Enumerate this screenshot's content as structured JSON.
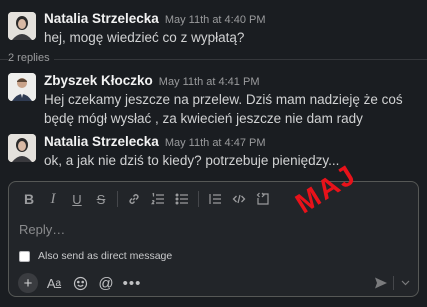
{
  "messages": [
    {
      "author": "Natalia Strzelecka",
      "time": "May 11th at 4:40 PM",
      "text": "hej, mogę wiedzieć co z wypłatą?",
      "avatar_icon": "user-avatar-portrait"
    },
    {
      "author": "Zbyszek Kłoczko",
      "time": "May 11th at 4:41 PM",
      "text": "Hej czekamy jeszcze na przelew. Dziś mam nadzieję że coś będę mógł wysłać , za kwiecień jeszcze nie dam rady",
      "avatar_icon": "user-avatar-suit"
    },
    {
      "author": "Natalia Strzelecka",
      "time": "May 11th at 4:47 PM",
      "text": "ok, a jak nie dziś to kiedy? potrzebuje pieniędzy...",
      "avatar_icon": "user-avatar-portrait"
    }
  ],
  "thread": {
    "replies_label": "2 replies"
  },
  "composer": {
    "placeholder": "Reply…",
    "also_send_label": "Also send as direct message",
    "toolbar_icons": [
      "bold",
      "italic",
      "underline",
      "strikethrough",
      "link",
      "ordered-list",
      "bulleted-list",
      "blockquote",
      "code",
      "code-block"
    ],
    "bottom_icons": [
      "plus",
      "formatting",
      "emoji",
      "mention",
      "more"
    ],
    "send_icon": "send"
  },
  "annotation": {
    "stamp_text": "MAJ",
    "color": "#e8121a"
  },
  "colors": {
    "background": "#1a1d21",
    "composer_bg": "#222529",
    "text": "#d1d2d3"
  }
}
